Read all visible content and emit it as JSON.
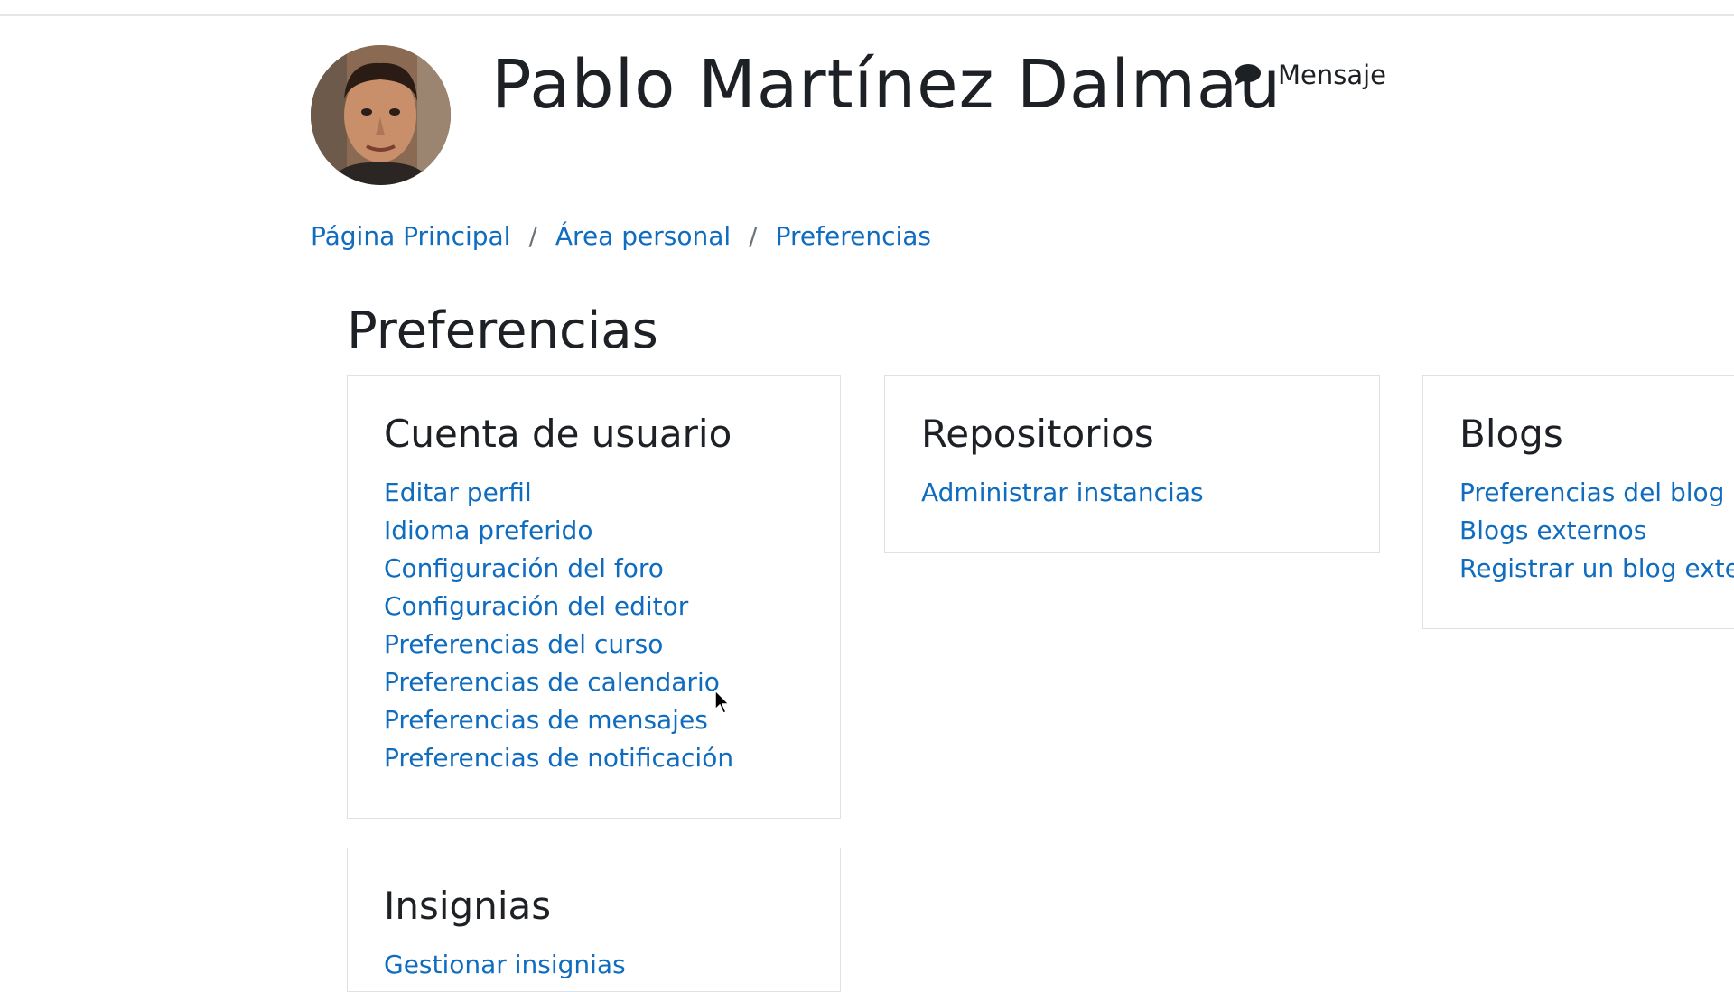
{
  "header": {
    "user_name": "Pablo Martínez Dalmau",
    "message_label": "Mensaje"
  },
  "breadcrumb": [
    {
      "label": "Página Principal"
    },
    {
      "label": "Área personal"
    },
    {
      "label": "Preferencias"
    }
  ],
  "breadcrumb_separator": "/",
  "page_title": "Preferencias",
  "cards": {
    "account": {
      "title": "Cuenta de usuario",
      "links": [
        "Editar perfil",
        "Idioma preferido",
        "Configuración del foro",
        "Configuración del editor",
        "Preferencias del curso",
        "Preferencias de calendario",
        "Preferencias de mensajes",
        "Preferencias de notificación"
      ]
    },
    "repos": {
      "title": "Repositorios",
      "links": [
        "Administrar instancias"
      ]
    },
    "blogs": {
      "title": "Blogs",
      "links": [
        "Preferencias del blog",
        "Blogs externos",
        "Registrar un blog externo"
      ]
    },
    "badges": {
      "title": "Insignias",
      "links": [
        "Gestionar insignias"
      ]
    }
  },
  "colors": {
    "link": "#0f6cbf",
    "text": "#1d2125",
    "border": "#dee2e6"
  },
  "icons": {
    "message": "speech-bubble-icon",
    "cursor": "mouse-pointer-icon"
  }
}
